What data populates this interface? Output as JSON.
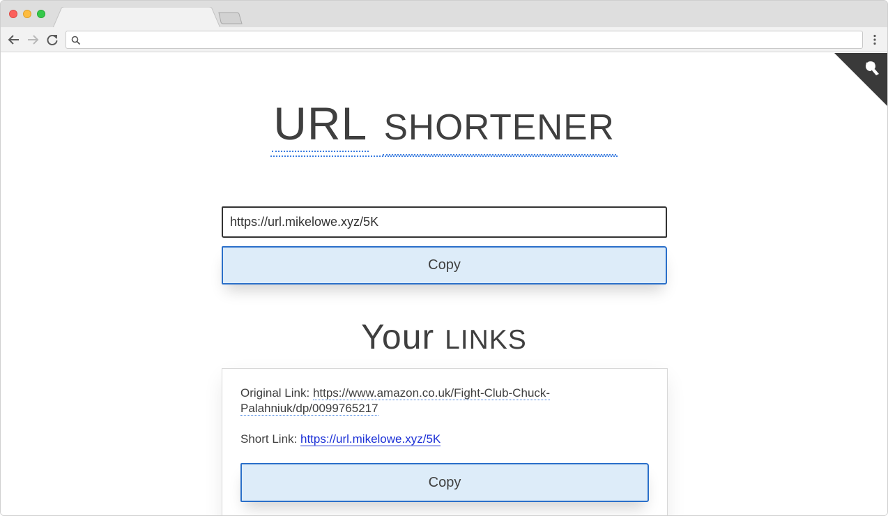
{
  "browser": {
    "tab_title": "",
    "address_bar_value": ""
  },
  "page": {
    "title_first": "URL",
    "title_second": "Shortener",
    "short_url_value": "https://url.mikelowe.xyz/5K",
    "copy_button_label": "Copy",
    "links_title_first": "Your",
    "links_title_second": "Links"
  },
  "links": [
    {
      "original_label": "Original Link:",
      "original_url": "https://www.amazon.co.uk/Fight-Club-Chuck-Palahniuk/dp/0099765217",
      "short_label": "Short Link:",
      "short_url": "https://url.mikelowe.xyz/5K",
      "copy_label": "Copy"
    }
  ],
  "colors": {
    "button_bg": "#ddecf9",
    "button_border": "#2a6fc9",
    "text": "#3f3f3f",
    "link_blue": "#1a2fd6",
    "github_corner": "#3a3a3a"
  },
  "icons": {
    "corner": "github-octocat-icon"
  }
}
